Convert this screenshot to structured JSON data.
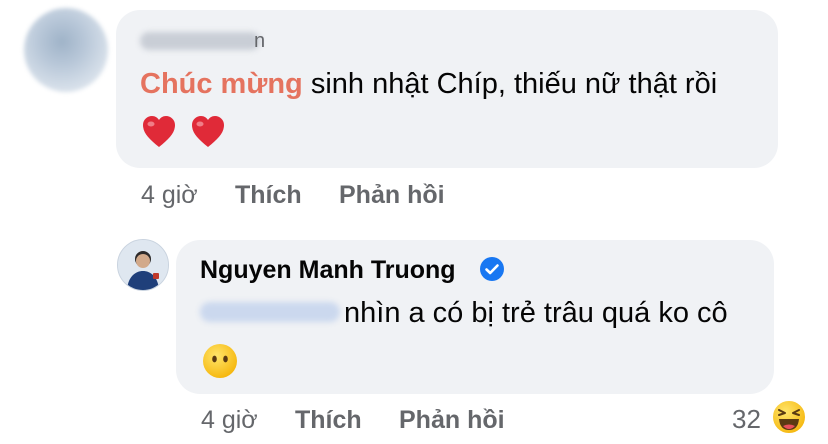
{
  "comments": [
    {
      "author_partial": "n",
      "text_highlight": "Chúc mừng",
      "text_rest": " sinh nhật Chíp, thiếu nữ thật rồi",
      "emoji": [
        "red-heart",
        "red-heart"
      ],
      "time": "4 giờ",
      "like_label": "Thích",
      "reply_label": "Phản hồi"
    },
    {
      "author": "Nguyen Manh Truong",
      "verified": true,
      "text": "nhìn a có bị trẻ trâu quá ko cô",
      "emoji": [
        "face-without-mouth"
      ],
      "time": "4 giờ",
      "like_label": "Thích",
      "reply_label": "Phản hồi",
      "reaction_count": "32",
      "reaction_icon": "laughing-face"
    }
  ],
  "colors": {
    "highlight": "#e5735f",
    "verified": "#1877f2",
    "bubble": "#f0f2f5",
    "meta": "#65676b"
  }
}
